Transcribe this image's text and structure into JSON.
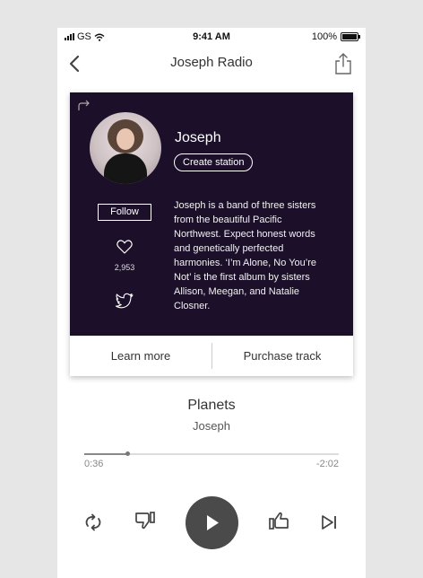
{
  "status_bar": {
    "carrier": "GS",
    "time": "9:41 AM",
    "battery": "100%"
  },
  "nav": {
    "title": "Joseph Radio",
    "back_icon": "chevron-left-icon",
    "share_icon": "share-icon"
  },
  "artist_card": {
    "name": "Joseph",
    "create_station_label": "Create station",
    "follow_label": "Follow",
    "like_count": "2,953",
    "bio": "Joseph is a band of three sisters from the beautiful Pacific Northwest. Expect honest words and genetically perfected harmonies.  ‘I’m Alone, No You’re Not’ is the first album by sisters Allison, Meegan, and Natalie Closner.",
    "learn_more_label": "Learn more",
    "purchase_label": "Purchase track",
    "background_color": "#1b0f2a"
  },
  "track": {
    "title": "Planets",
    "artist": "Joseph"
  },
  "playback": {
    "elapsed": "0:36",
    "remaining": "-2:02",
    "progress_fraction": 0.17
  },
  "controls": [
    "repeat-icon",
    "thumbs-down-icon",
    "play-icon",
    "thumbs-up-icon",
    "skip-next-icon"
  ]
}
